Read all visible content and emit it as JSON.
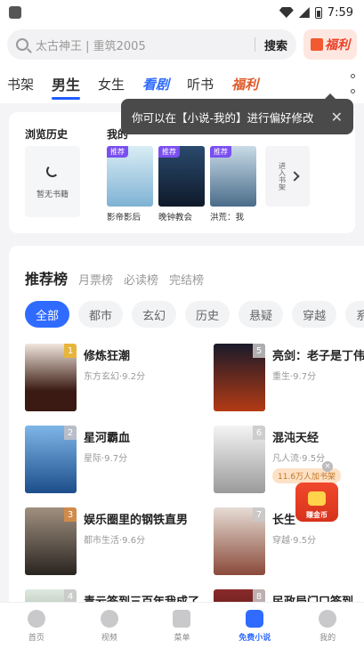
{
  "status": {
    "time": "7:59"
  },
  "search": {
    "placeholder": "太古神王 | 重筑2005",
    "button": "搜索",
    "gift_label": "福利"
  },
  "tabs": [
    {
      "label": "书架"
    },
    {
      "label": "男生"
    },
    {
      "label": "女生"
    },
    {
      "label": "看剧"
    },
    {
      "label": "听书"
    },
    {
      "label": "福利"
    }
  ],
  "tooltip": {
    "text": "你可以在【小说-我的】进行偏好修改",
    "close": "✕"
  },
  "history": {
    "title": "浏览历史",
    "my_title": "我的",
    "empty_text": "暂无书籍",
    "books": [
      {
        "badge": "推荐",
        "name": "影帝影后"
      },
      {
        "badge": "推荐",
        "name": "晚钟教会"
      },
      {
        "badge": "推荐",
        "name": "洪荒：我"
      }
    ],
    "enter_shelf": "进入书架"
  },
  "rank": {
    "tabs": [
      "推荐榜",
      "月票榜",
      "必读榜",
      "完结榜"
    ],
    "chips": [
      "全部",
      "都市",
      "玄幻",
      "历史",
      "悬疑",
      "穿越",
      "系统"
    ],
    "items": [
      {
        "num": "1",
        "title": "修炼狂潮",
        "meta": "东方玄幻·9.2分",
        "color": "#3a1a12"
      },
      {
        "num": "2",
        "title": "星河霸血",
        "meta": "星际·9.7分",
        "color": "#1c4e8a"
      },
      {
        "num": "3",
        "title": "娱乐圈里的钢铁直男",
        "meta": "都市生活·9.6分",
        "color": "#2a2520"
      },
      {
        "num": "4",
        "title": "青云签到三百年我成了",
        "meta": "",
        "color": "#6a8a6a"
      },
      {
        "num": "5",
        "title": "亮剑：老子是丁伟",
        "meta": "重生·9.7分",
        "color": "#b33a14"
      },
      {
        "num": "6",
        "title": "混沌天经",
        "meta": "凡人流·9.5分",
        "color": "#d9d9d9"
      },
      {
        "num": "7",
        "title": "长生",
        "meta": "穿越·9.5分",
        "color": "#b8a59a"
      },
      {
        "num": "8",
        "title": "民政局门口签到",
        "meta": "",
        "color": "#5a1a1a"
      }
    ]
  },
  "float_ad": {
    "bubble": "11.6万人加书架",
    "label": "赚金币"
  },
  "bottom_nav": [
    {
      "label": "首页"
    },
    {
      "label": "视频"
    },
    {
      "label": "菜单"
    },
    {
      "label": "免费小说"
    },
    {
      "label": "我的"
    }
  ]
}
